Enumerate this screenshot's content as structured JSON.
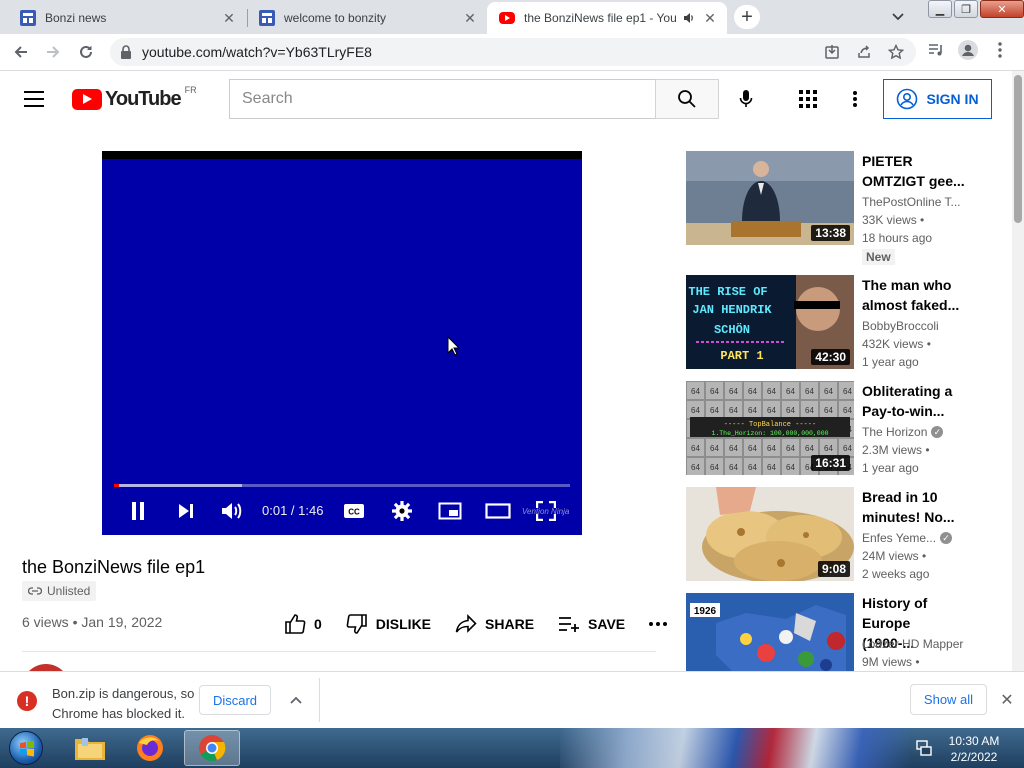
{
  "browser": {
    "tabs": [
      {
        "label": "Bonzi news",
        "icon": "news-favicon",
        "active": false
      },
      {
        "label": "welcome to bonzity",
        "icon": "news-favicon",
        "active": false
      },
      {
        "label": "the BonziNews file ep1 - You",
        "icon": "youtube-favicon",
        "active": true
      }
    ],
    "url": "youtube.com/watch?v=Yb63TLryFE8"
  },
  "youtube": {
    "logo_text": "YouTube",
    "country_code": "FR",
    "search_placeholder": "Search",
    "sign_in_label": "SIGN IN"
  },
  "player": {
    "time_display": "0:01 / 1:46",
    "progress_played_fraction": 0.004,
    "progress_loaded_fraction": 0.28,
    "watermark": "Vention Ninja"
  },
  "video": {
    "title": "the BonziNews file ep1",
    "visibility": "Unlisted",
    "views": "6 views",
    "date": "Jan 19, 2022",
    "likes": "0",
    "dislike_label": "DISLIKE",
    "share_label": "SHARE",
    "save_label": "SAVE"
  },
  "recommendations": [
    {
      "title": "PIETER OMTZIGT gee...",
      "channel": "ThePostOnline T...",
      "verified": false,
      "views": "33K views",
      "age": "18 hours ago",
      "badge": "New",
      "duration": "13:38"
    },
    {
      "title": "The man who almost faked...",
      "channel": "BobbyBroccoli",
      "verified": false,
      "views": "432K views",
      "age": "1 year ago",
      "badge": "",
      "duration": "42:30",
      "thumb_text": [
        "THE RISE OF",
        "JAN HENDRIK",
        "SCHÖN",
        "PART 1"
      ]
    },
    {
      "title": "Obliterating a Pay-to-win...",
      "channel": "The Horizon",
      "verified": true,
      "views": "2.3M views",
      "age": "1 year ago",
      "badge": "",
      "duration": "16:31",
      "thumb_text": [
        "----- TopBalance -----",
        "1.The_Horizon: 100,000,000,000"
      ]
    },
    {
      "title": "Bread in 10 minutes! No...",
      "channel": "Enfes Yeme...",
      "verified": true,
      "views": "24M views",
      "age": "2 weeks ago",
      "badge": "",
      "duration": "9:08"
    },
    {
      "title": "History of Europe (1900-...",
      "channel": "Lodzer HD Mapper",
      "verified": false,
      "views": "9M views",
      "age": "",
      "badge": "",
      "duration": "",
      "thumb_text": [
        "1926"
      ]
    }
  ],
  "download_bar": {
    "message": "Bon.zip is dangerous, so Chrome has blocked it.",
    "discard_label": "Discard",
    "show_all_label": "Show all"
  },
  "taskbar": {
    "time": "10:30 AM",
    "date": "2/2/2022",
    "apps": [
      "windows-explorer",
      "firefox",
      "chrome"
    ]
  },
  "colors": {
    "video_background": "#0000a8",
    "youtube_red": "#ff0000",
    "link_blue": "#065fd4",
    "danger_red": "#d93025"
  }
}
